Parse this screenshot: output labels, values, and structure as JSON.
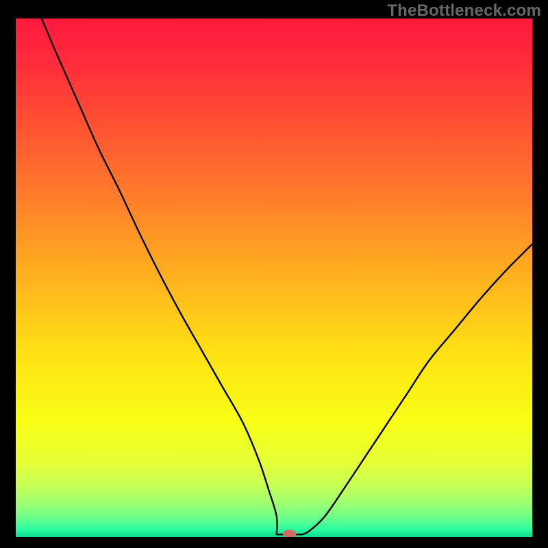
{
  "watermark": "TheBottleneck.com",
  "chart_data": {
    "type": "line",
    "title": "",
    "xlabel": "",
    "ylabel": "",
    "xlim": [
      0,
      100
    ],
    "ylim": [
      0,
      100
    ],
    "grid": false,
    "legend": false,
    "background_gradient_stops": [
      {
        "offset": 0.0,
        "color": "#ff1a3e"
      },
      {
        "offset": 0.08,
        "color": "#ff2a3c"
      },
      {
        "offset": 0.2,
        "color": "#ff5033"
      },
      {
        "offset": 0.35,
        "color": "#ff7f2a"
      },
      {
        "offset": 0.5,
        "color": "#ffb21f"
      },
      {
        "offset": 0.65,
        "color": "#ffe214"
      },
      {
        "offset": 0.78,
        "color": "#f8ff15"
      },
      {
        "offset": 0.86,
        "color": "#e3ff3a"
      },
      {
        "offset": 0.9,
        "color": "#c8ff55"
      },
      {
        "offset": 0.93,
        "color": "#a4ff6e"
      },
      {
        "offset": 0.96,
        "color": "#72ff88"
      },
      {
        "offset": 0.985,
        "color": "#2cfca0"
      },
      {
        "offset": 1.0,
        "color": "#0bd98c"
      }
    ],
    "series": [
      {
        "name": "bottleneck-curve",
        "color": "#000000",
        "stroke_width": 2.4,
        "x": [
          5,
          8,
          12,
          16,
          20,
          24,
          28,
          32,
          36,
          40,
          44,
          47,
          49,
          50.5,
          52,
          53.5,
          55,
          57,
          60,
          64,
          68,
          72,
          76,
          80,
          85,
          90,
          95,
          100
        ],
        "y": [
          100,
          93,
          84,
          75,
          67,
          58.5,
          50.5,
          43,
          36,
          29,
          22,
          15,
          9,
          4,
          1.2,
          0.5,
          0.5,
          1.3,
          4.2,
          10,
          16,
          22,
          28,
          34,
          40,
          46,
          51.5,
          56.5
        ]
      }
    ],
    "flat_bottom": {
      "x_start": 50.5,
      "x_end": 55.5,
      "y": 0.5
    },
    "marker": {
      "x": 53,
      "y": 0.6,
      "color": "#d06a66",
      "rx": 10,
      "ry": 6
    }
  }
}
